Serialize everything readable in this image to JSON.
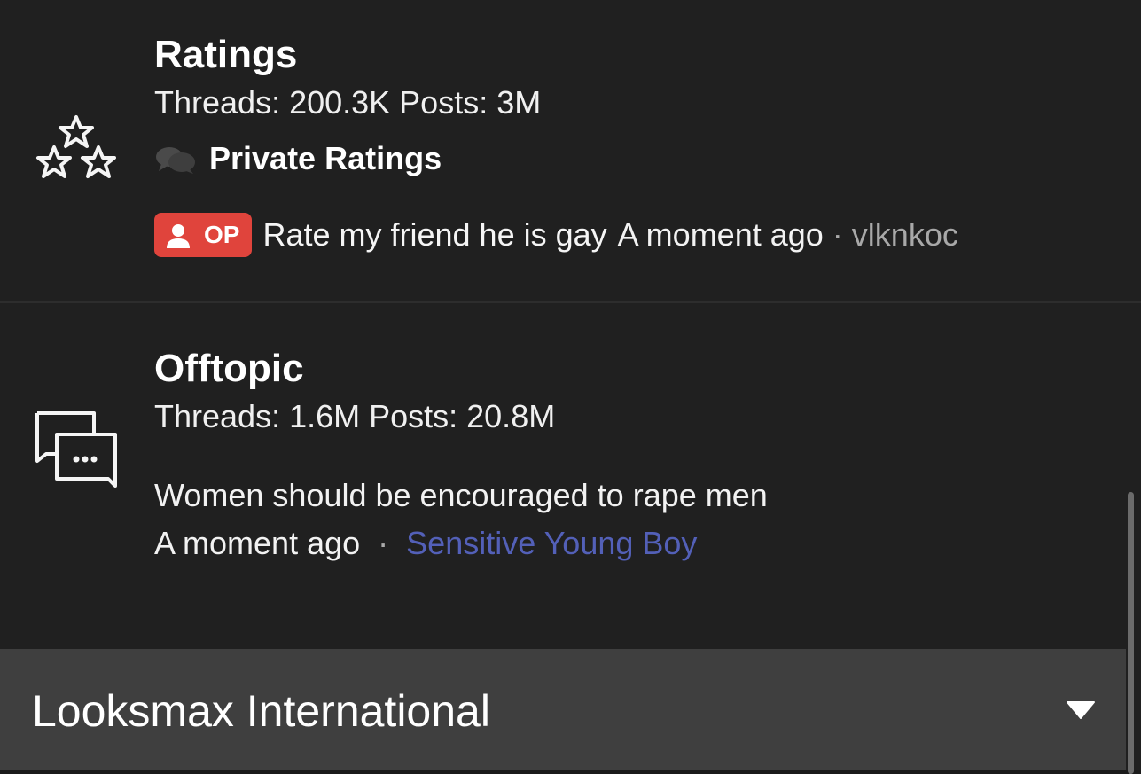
{
  "forums": [
    {
      "title": "Ratings",
      "icon": "stars-icon",
      "stats": "Threads: 200.3K Posts: 3M",
      "subforum": {
        "icon": "chat-bubbles-icon",
        "label": "Private Ratings"
      },
      "latest": {
        "badge": "OP",
        "badge_color": "#e0443c",
        "title": "Rate my friend he is gay",
        "time": "A moment ago",
        "separator": "·",
        "author": "vlknkoc"
      }
    },
    {
      "title": "Offtopic",
      "icon": "chat-bubbles-icon",
      "stats": "Threads: 1.6M Posts: 20.8M",
      "latest": {
        "title": "Women should be encouraged to rape men",
        "time": "A moment ago",
        "separator": "·",
        "author": "Sensitive Young Boy",
        "author_color": "#5360b8"
      }
    }
  ],
  "section_bar": {
    "title": "Looksmax International",
    "icon": "chevron-down-icon"
  }
}
